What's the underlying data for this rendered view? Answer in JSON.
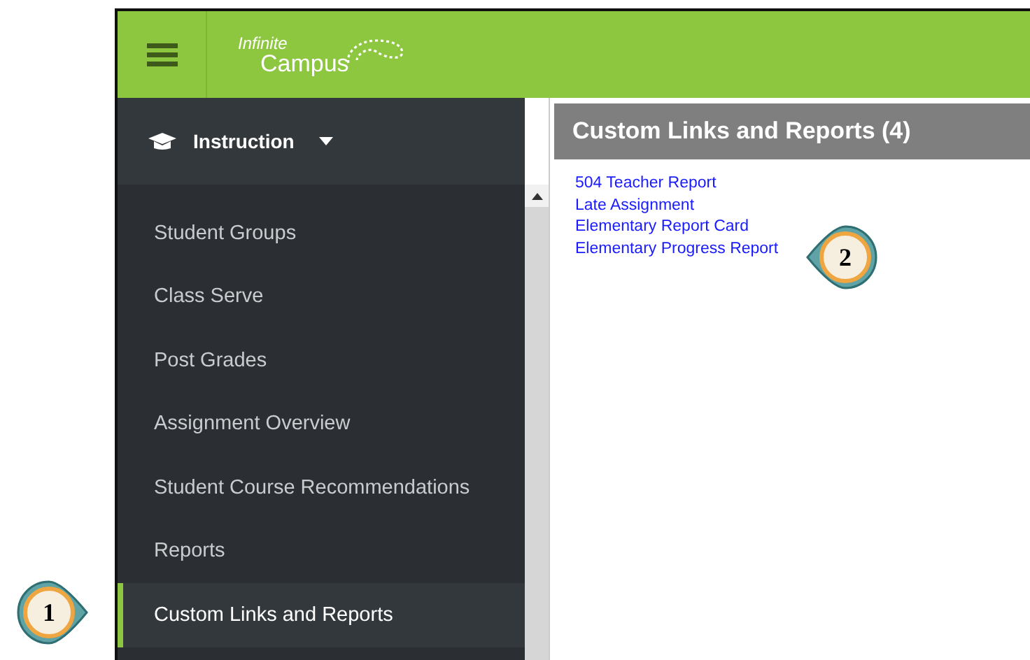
{
  "header": {
    "logo_line_1": "Infinite",
    "logo_line_2": "Campus"
  },
  "sidebar": {
    "module": {
      "label": "Instruction",
      "expanded": false
    },
    "items": [
      {
        "label": "Student Groups",
        "selected": false
      },
      {
        "label": "Class Serve",
        "selected": false
      },
      {
        "label": "Post Grades",
        "selected": false
      },
      {
        "label": "Assignment Overview",
        "selected": false
      },
      {
        "label": "Student Course Recommendations",
        "selected": false
      },
      {
        "label": "Reports",
        "selected": false
      },
      {
        "label": "Custom Links and Reports",
        "selected": true
      }
    ]
  },
  "panel": {
    "title": "Custom Links and Reports (4)",
    "links": [
      "504 Teacher Report",
      "Late Assignment",
      "Elementary Report Card",
      "Elementary Progress Report"
    ]
  },
  "callouts": [
    {
      "number": "1",
      "kind": "rightward"
    },
    {
      "number": "2",
      "kind": "leftward"
    }
  ]
}
